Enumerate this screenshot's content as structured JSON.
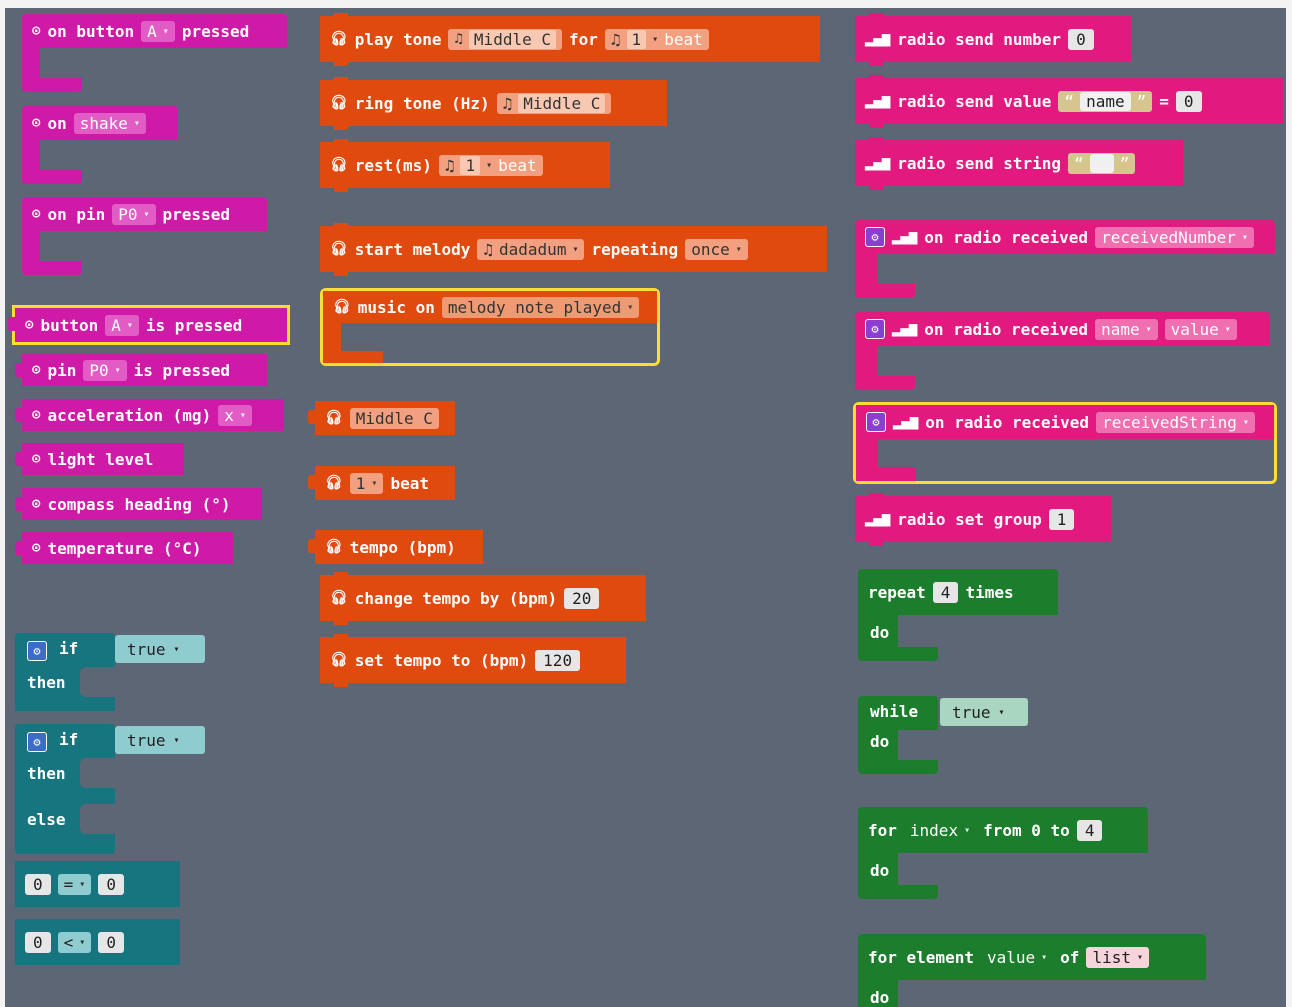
{
  "input": {
    "on_button": {
      "prefix": "on button",
      "value": "A",
      "suffix": "pressed"
    },
    "on_shake": {
      "prefix": "on",
      "value": "shake"
    },
    "on_pin": {
      "prefix": "on pin",
      "value": "P0",
      "suffix": "pressed"
    },
    "button_is_pressed": {
      "prefix": "button",
      "value": "A",
      "suffix": "is pressed"
    },
    "pin_is_pressed": {
      "prefix": "pin",
      "value": "P0",
      "suffix": "is pressed"
    },
    "acceleration": {
      "label": "acceleration (mg)",
      "value": "x"
    },
    "light_level": "light level",
    "compass_heading": "compass heading (°)",
    "temperature": "temperature (°C)"
  },
  "logic": {
    "if": "if",
    "then": "then",
    "else": "else",
    "true": "true",
    "compare_eq": {
      "left": "0",
      "op": "=",
      "right": "0"
    },
    "compare_lt": {
      "left": "0",
      "op": "<",
      "right": "0"
    }
  },
  "music": {
    "play_tone": {
      "label": "play tone",
      "note": "Middle C",
      "for": "for",
      "beat_value": "1",
      "beat": "beat"
    },
    "ring_tone": {
      "label": "ring tone (Hz)",
      "note": "Middle C"
    },
    "rest": {
      "label": "rest(ms)",
      "beat_value": "1",
      "beat": "beat"
    },
    "start_melody": {
      "label": "start melody",
      "melody": "dadadum",
      "repeating": "repeating",
      "option": "once"
    },
    "music_on": {
      "label": "music on",
      "event": "melody note played"
    },
    "note_value": "Middle C",
    "beat_block": {
      "value": "1",
      "unit": "beat"
    },
    "tempo": "tempo (bpm)",
    "change_tempo": {
      "label": "change tempo by (bpm)",
      "value": "20"
    },
    "set_tempo": {
      "label": "set tempo to (bpm)",
      "value": "120"
    }
  },
  "radio": {
    "send_number": {
      "label": "radio send number",
      "value": "0"
    },
    "send_value": {
      "label": "radio send value",
      "name": "name",
      "eq": "=",
      "value": "0"
    },
    "send_string": {
      "label": "radio send string"
    },
    "received_number": {
      "label": "on radio received",
      "var": "receivedNumber"
    },
    "received_value": {
      "label": "on radio received",
      "var1": "name",
      "var2": "value"
    },
    "received_string": {
      "label": "on radio received",
      "var": "receivedString"
    },
    "set_group": {
      "label": "radio set group",
      "value": "1"
    }
  },
  "loops": {
    "repeat": {
      "label": "repeat",
      "value": "4",
      "suffix": "times"
    },
    "do": "do",
    "while": {
      "label": "while",
      "value": "true"
    },
    "for_index": {
      "label": "for",
      "var": "index",
      "from": "from 0 to",
      "value": "4"
    },
    "for_element": {
      "label": "for element",
      "var": "value",
      "of": "of",
      "list": "list"
    }
  },
  "colors": {
    "input": "#cf1aa8",
    "music": "#e04a0e",
    "radio": "#e2197f",
    "loops": "#1c7d2c",
    "logic": "#17757f",
    "workspace": "#5d6674",
    "highlight": "#ffdd33"
  },
  "icons": {
    "input": "target-icon",
    "music": "headphones-icon",
    "radio": "signal-icon",
    "settings": "gear-icon"
  }
}
